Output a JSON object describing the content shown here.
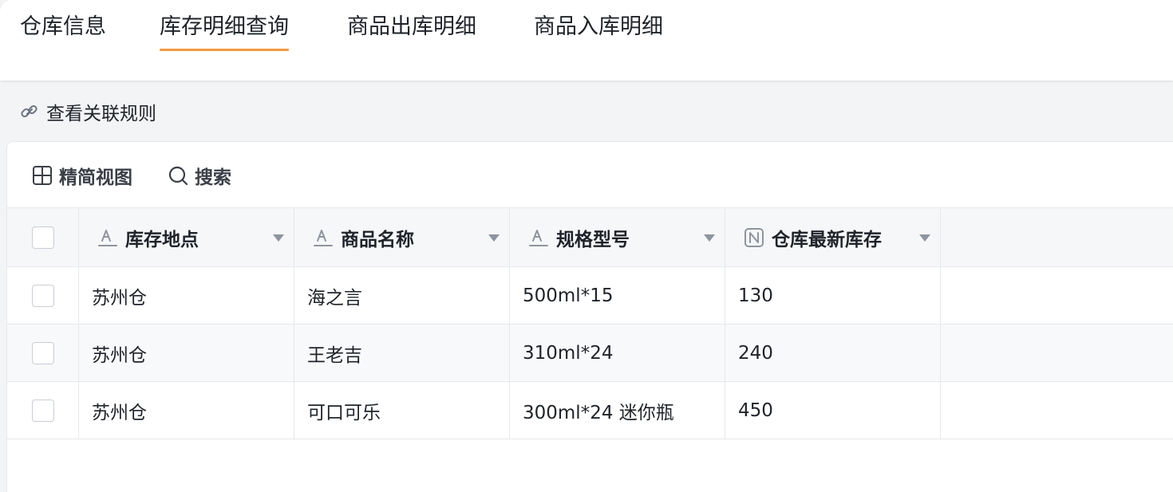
{
  "tabs": [
    {
      "label": "仓库信息",
      "active": false
    },
    {
      "label": "库存明细查询",
      "active": true
    },
    {
      "label": "商品出库明细",
      "active": false
    },
    {
      "label": "商品入库明细",
      "active": false
    }
  ],
  "rules_link": {
    "label": "查看关联规则",
    "icon": "link-icon"
  },
  "toolbar": {
    "compact_view_label": "精简视图",
    "compact_view_icon": "grid-icon",
    "search_label": "搜索",
    "search_icon": "search-icon"
  },
  "table": {
    "columns": [
      {
        "label": "库存地点",
        "type_icon": "text-type-icon"
      },
      {
        "label": "商品名称",
        "type_icon": "text-type-icon"
      },
      {
        "label": "规格型号",
        "type_icon": "text-type-icon"
      },
      {
        "label": "仓库最新库存",
        "type_icon": "number-type-icon"
      }
    ],
    "rows": [
      [
        "苏州仓",
        "海之言",
        "500ml*15",
        "130"
      ],
      [
        "苏州仓",
        "王老吉",
        "310ml*24",
        "240"
      ],
      [
        "苏州仓",
        "可口可乐",
        "300ml*24 迷你瓶",
        "450"
      ]
    ]
  },
  "colors": {
    "active_tab_underline": "#f59842",
    "border": "#e6e8eb",
    "header_bg": "#f6f7f9"
  }
}
